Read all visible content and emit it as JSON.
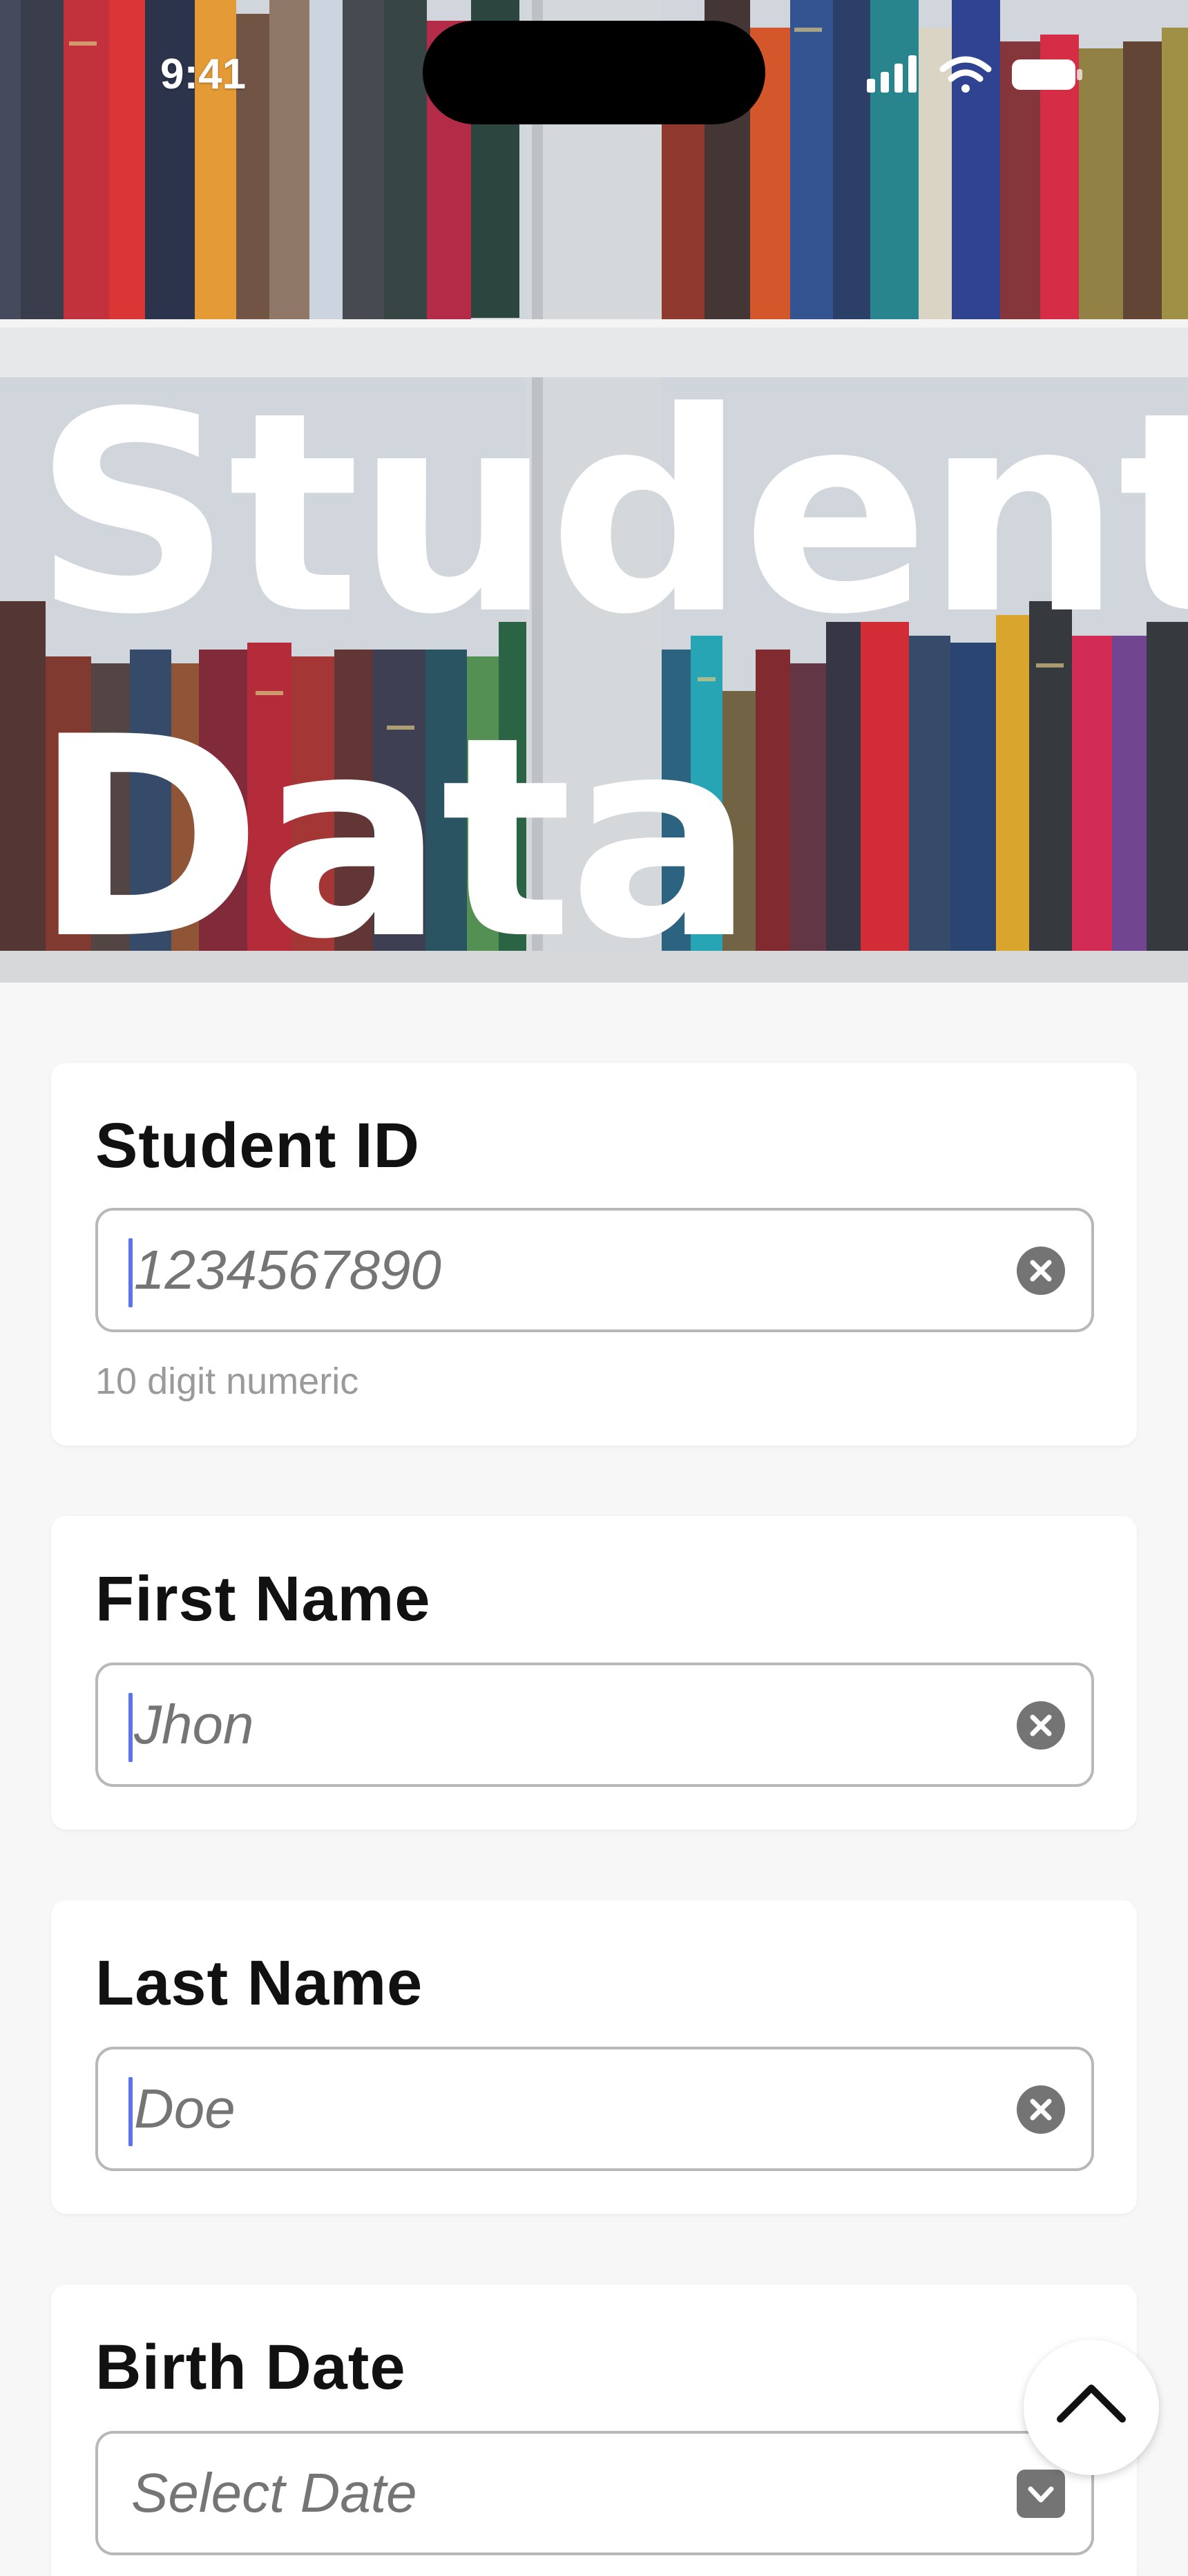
{
  "status_bar": {
    "time": "9:41",
    "icons": [
      "signal-icon",
      "wifi-icon",
      "battery-icon"
    ]
  },
  "hero": {
    "title": "Student\nData",
    "background": "bookshelf-photo"
  },
  "form": {
    "fields": [
      {
        "label": "Student ID",
        "placeholder": "1234567890",
        "value": "",
        "helper": "10 digit numeric",
        "trailing_icon": "clear-icon"
      },
      {
        "label": "First Name",
        "placeholder": "Jhon",
        "value": "",
        "trailing_icon": "clear-icon"
      },
      {
        "label": "Last Name",
        "placeholder": "Doe",
        "value": "",
        "trailing_icon": "clear-icon"
      },
      {
        "label": "Birth Date",
        "placeholder": "Select Date",
        "value": "",
        "trailing_icon": "chevron-down-icon"
      }
    ]
  },
  "scroll_top_button": {
    "icon": "chevron-up-icon"
  },
  "colors": {
    "caret": "#5b74e8",
    "card_background": "#ffffff",
    "page_background": "#f7f7f7",
    "input_border": "#b8b8b8",
    "icon_fill": "#747474",
    "placeholder": "#b0b0b0"
  }
}
